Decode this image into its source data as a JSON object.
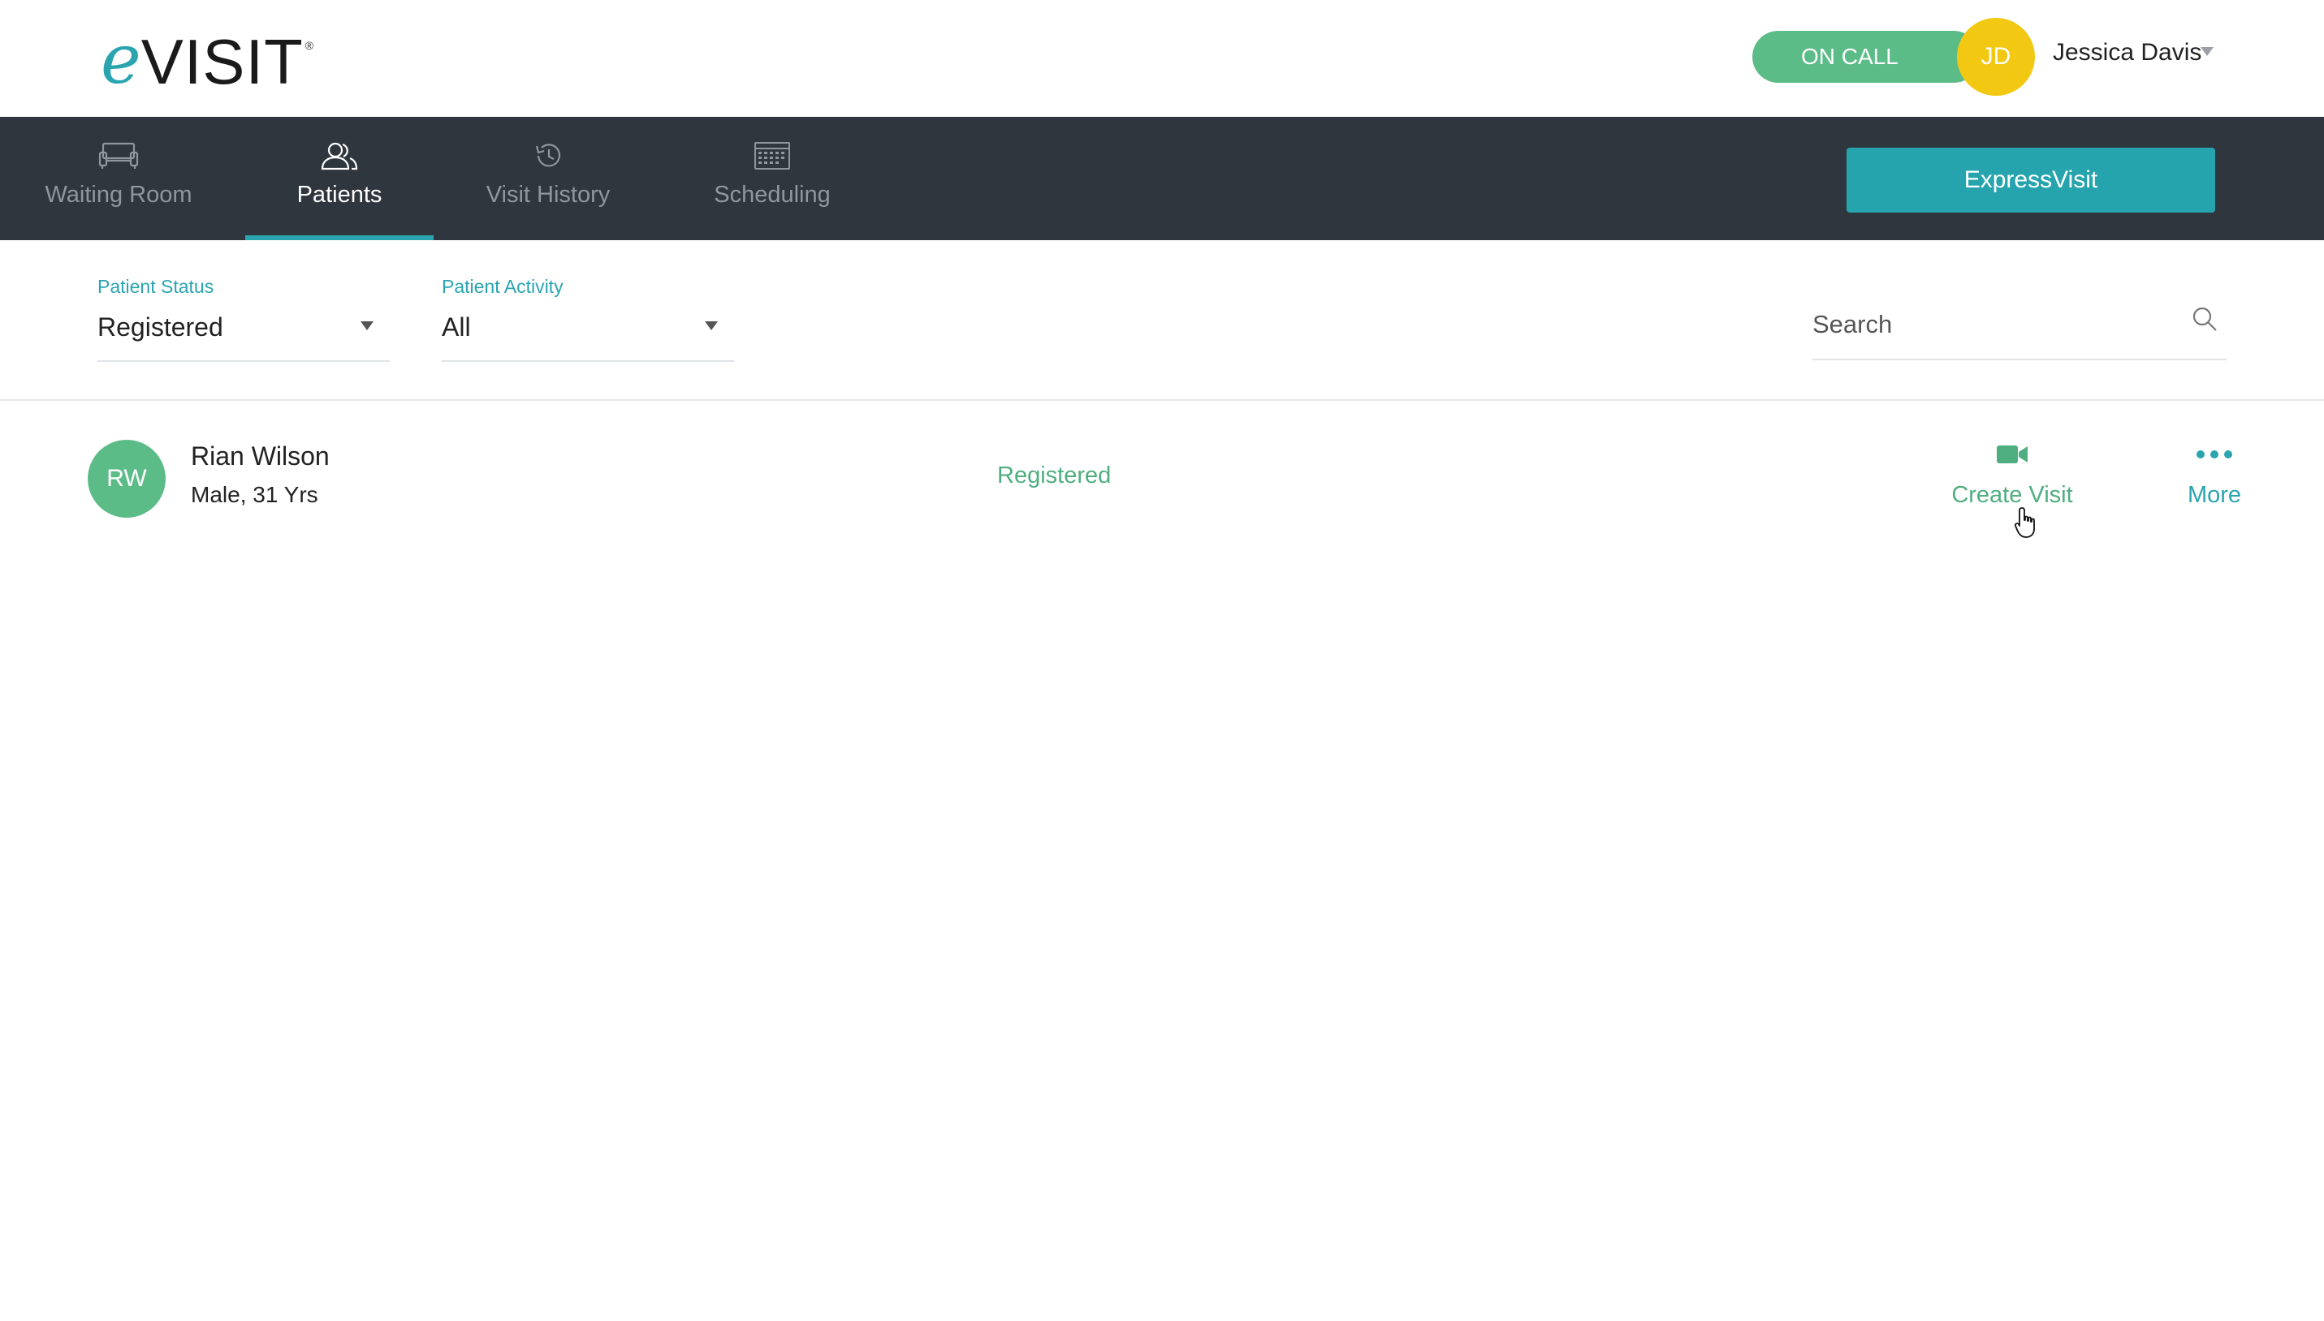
{
  "app": {
    "logo_e": "e",
    "logo_rest": "VISIT",
    "logo_reg": "®"
  },
  "header": {
    "status_toggle": "ON CALL",
    "user_initials": "JD",
    "user_name": "Jessica Davis"
  },
  "nav": {
    "tabs": [
      {
        "label": "Waiting Room",
        "icon": "couch-icon",
        "active": false
      },
      {
        "label": "Patients",
        "icon": "users-icon",
        "active": true
      },
      {
        "label": "Visit History",
        "icon": "history-icon",
        "active": false
      },
      {
        "label": "Scheduling",
        "icon": "calendar-icon",
        "active": false
      }
    ],
    "express_button": "ExpressVisit"
  },
  "filters": {
    "status": {
      "label": "Patient Status",
      "value": "Registered"
    },
    "activity": {
      "label": "Patient Activity",
      "value": "All"
    },
    "search_placeholder": "Search"
  },
  "patients": [
    {
      "initials": "RW",
      "name": "Rian Wilson",
      "meta": "Male, 31 Yrs",
      "status": "Registered",
      "actions": {
        "create_visit": "Create Visit",
        "more": "More"
      }
    }
  ],
  "colors": {
    "accent_teal": "#2aa5b0",
    "green": "#5cbc88",
    "navbar": "#2f363d",
    "avatar_yellow": "#f3c812"
  }
}
